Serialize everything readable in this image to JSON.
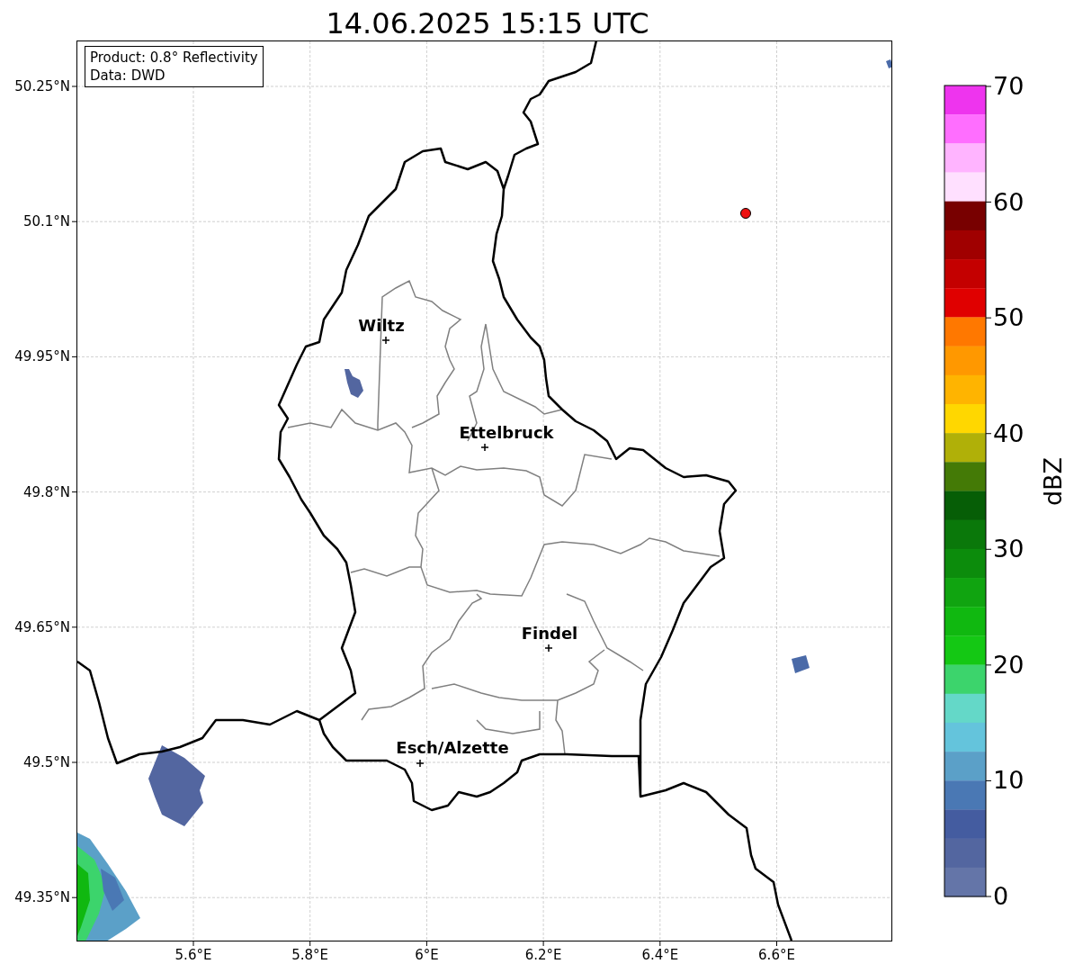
{
  "title": "14.06.2025 15:15 UTC",
  "map": {
    "info_box": [
      "Product: 0.8° Reflectivity",
      "Data: DWD"
    ],
    "y_ticks": [
      "50.25°N",
      "50.1°N",
      "49.95°N",
      "49.8°N",
      "49.65°N",
      "49.5°N",
      "49.35°N"
    ],
    "x_ticks": [
      "5.6°E",
      "5.8°E",
      "6°E",
      "6.2°E",
      "6.4°E",
      "6.6°E"
    ],
    "places": [
      {
        "name": "Wiltz"
      },
      {
        "name": "Ettelbruck"
      },
      {
        "name": "Findel"
      },
      {
        "name": "Esch/Alzette"
      }
    ]
  },
  "colorbar": {
    "label": "dBZ",
    "ticks": [
      "70",
      "60",
      "50",
      "40",
      "30",
      "20",
      "10",
      "0"
    ],
    "bands": [
      {
        "color": "#ee34ee"
      },
      {
        "color": "#ff6eff"
      },
      {
        "color": "#ffb4ff"
      },
      {
        "color": "#ffe0ff"
      },
      {
        "color": "#780000"
      },
      {
        "color": "#a00000"
      },
      {
        "color": "#c40000"
      },
      {
        "color": "#e00000"
      },
      {
        "color": "#ff7800"
      },
      {
        "color": "#ff9800"
      },
      {
        "color": "#ffb400"
      },
      {
        "color": "#ffd700"
      },
      {
        "color": "#b0b008"
      },
      {
        "color": "#447a06"
      },
      {
        "color": "#065e06"
      },
      {
        "color": "#0a780a"
      },
      {
        "color": "#0c8c0c"
      },
      {
        "color": "#10a410"
      },
      {
        "color": "#10b810"
      },
      {
        "color": "#14c814"
      },
      {
        "color": "#3cd46c"
      },
      {
        "color": "#64d8c8"
      },
      {
        "color": "#64c4dc"
      },
      {
        "color": "#5ba0c8"
      },
      {
        "color": "#4a78b4"
      },
      {
        "color": "#445ca0"
      },
      {
        "color": "#5366a0"
      },
      {
        "color": "#6475a8"
      }
    ]
  }
}
